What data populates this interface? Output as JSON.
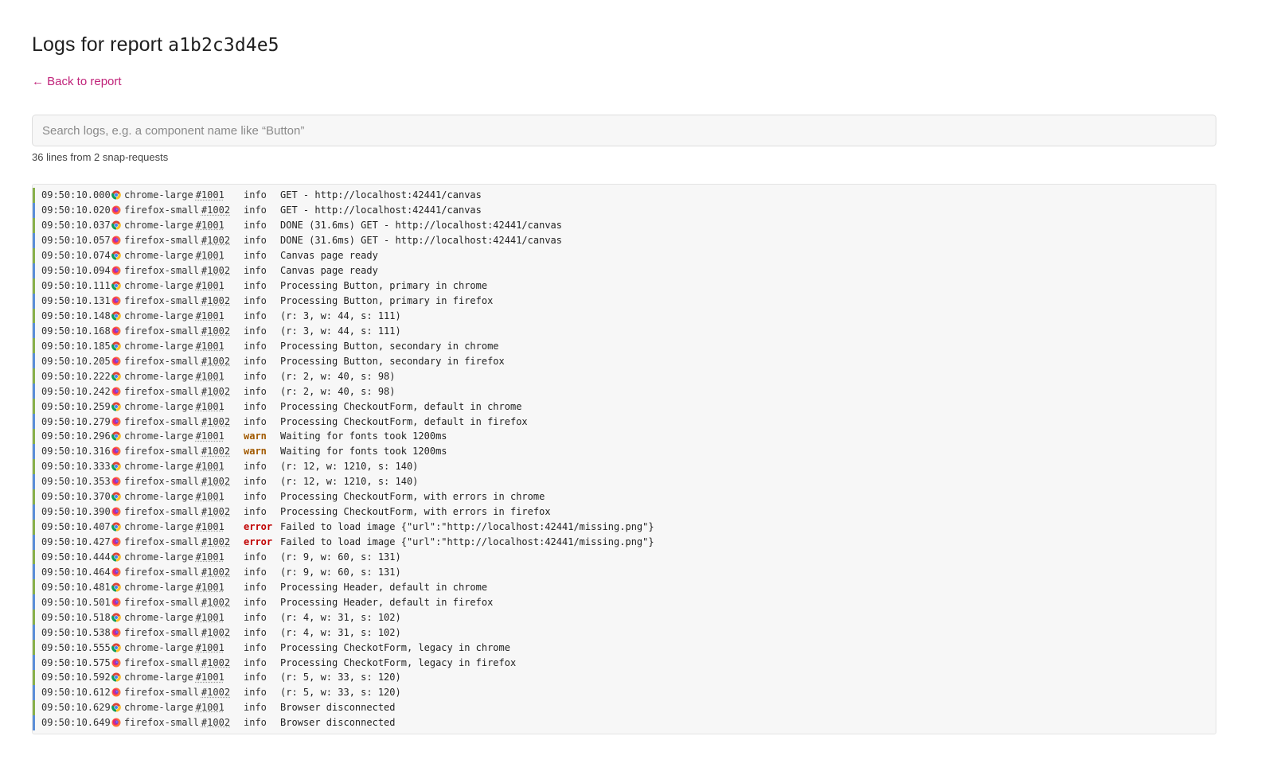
{
  "page": {
    "title_prefix": "Logs for report",
    "report_id": "a1b2c3d4e5",
    "back_link": "← Back to report",
    "search_placeholder": "Search logs, e.g. a component name like “Button”",
    "summary": "36 lines from 2 snap-requests"
  },
  "colors": {
    "chrome_accent": "#88b04b",
    "firefox_accent": "#5b8ed8",
    "link": "#c0237a",
    "warn": "#a15a00",
    "error": "#c00000"
  },
  "browsers": {
    "chrome": {
      "target": "chrome-large",
      "request": "#1001",
      "icon": "chrome-icon"
    },
    "firefox": {
      "target": "firefox-small",
      "request": "#1002",
      "icon": "firefox-icon"
    }
  },
  "logs": [
    {
      "ts": "09:50:10.000",
      "browser": "chrome",
      "level": "info",
      "msg": "GET - http://localhost:42441/canvas"
    },
    {
      "ts": "09:50:10.020",
      "browser": "firefox",
      "level": "info",
      "msg": "GET - http://localhost:42441/canvas"
    },
    {
      "ts": "09:50:10.037",
      "browser": "chrome",
      "level": "info",
      "msg": "DONE (31.6ms) GET - http://localhost:42441/canvas"
    },
    {
      "ts": "09:50:10.057",
      "browser": "firefox",
      "level": "info",
      "msg": "DONE (31.6ms) GET - http://localhost:42441/canvas"
    },
    {
      "ts": "09:50:10.074",
      "browser": "chrome",
      "level": "info",
      "msg": "Canvas page ready"
    },
    {
      "ts": "09:50:10.094",
      "browser": "firefox",
      "level": "info",
      "msg": "Canvas page ready"
    },
    {
      "ts": "09:50:10.111",
      "browser": "chrome",
      "level": "info",
      "msg": "Processing Button, primary in chrome"
    },
    {
      "ts": "09:50:10.131",
      "browser": "firefox",
      "level": "info",
      "msg": "Processing Button, primary in firefox"
    },
    {
      "ts": "09:50:10.148",
      "browser": "chrome",
      "level": "info",
      "msg": "(r: 3, w: 44, s: 111)"
    },
    {
      "ts": "09:50:10.168",
      "browser": "firefox",
      "level": "info",
      "msg": "(r: 3, w: 44, s: 111)"
    },
    {
      "ts": "09:50:10.185",
      "browser": "chrome",
      "level": "info",
      "msg": "Processing Button, secondary in chrome"
    },
    {
      "ts": "09:50:10.205",
      "browser": "firefox",
      "level": "info",
      "msg": "Processing Button, secondary in firefox"
    },
    {
      "ts": "09:50:10.222",
      "browser": "chrome",
      "level": "info",
      "msg": "(r: 2, w: 40, s: 98)"
    },
    {
      "ts": "09:50:10.242",
      "browser": "firefox",
      "level": "info",
      "msg": "(r: 2, w: 40, s: 98)"
    },
    {
      "ts": "09:50:10.259",
      "browser": "chrome",
      "level": "info",
      "msg": "Processing CheckoutForm, default in chrome"
    },
    {
      "ts": "09:50:10.279",
      "browser": "firefox",
      "level": "info",
      "msg": "Processing CheckoutForm, default in firefox"
    },
    {
      "ts": "09:50:10.296",
      "browser": "chrome",
      "level": "warn",
      "msg": "Waiting for fonts took 1200ms"
    },
    {
      "ts": "09:50:10.316",
      "browser": "firefox",
      "level": "warn",
      "msg": "Waiting for fonts took 1200ms"
    },
    {
      "ts": "09:50:10.333",
      "browser": "chrome",
      "level": "info",
      "msg": "(r: 12, w: 1210, s: 140)"
    },
    {
      "ts": "09:50:10.353",
      "browser": "firefox",
      "level": "info",
      "msg": "(r: 12, w: 1210, s: 140)"
    },
    {
      "ts": "09:50:10.370",
      "browser": "chrome",
      "level": "info",
      "msg": "Processing CheckoutForm, with errors in chrome"
    },
    {
      "ts": "09:50:10.390",
      "browser": "firefox",
      "level": "info",
      "msg": "Processing CheckoutForm, with errors in firefox"
    },
    {
      "ts": "09:50:10.407",
      "browser": "chrome",
      "level": "error",
      "msg": "Failed to load image {\"url\":\"http://localhost:42441/missing.png\"}"
    },
    {
      "ts": "09:50:10.427",
      "browser": "firefox",
      "level": "error",
      "msg": "Failed to load image {\"url\":\"http://localhost:42441/missing.png\"}"
    },
    {
      "ts": "09:50:10.444",
      "browser": "chrome",
      "level": "info",
      "msg": "(r: 9, w: 60, s: 131)"
    },
    {
      "ts": "09:50:10.464",
      "browser": "firefox",
      "level": "info",
      "msg": "(r: 9, w: 60, s: 131)"
    },
    {
      "ts": "09:50:10.481",
      "browser": "chrome",
      "level": "info",
      "msg": "Processing Header, default in chrome"
    },
    {
      "ts": "09:50:10.501",
      "browser": "firefox",
      "level": "info",
      "msg": "Processing Header, default in firefox"
    },
    {
      "ts": "09:50:10.518",
      "browser": "chrome",
      "level": "info",
      "msg": "(r: 4, w: 31, s: 102)"
    },
    {
      "ts": "09:50:10.538",
      "browser": "firefox",
      "level": "info",
      "msg": "(r: 4, w: 31, s: 102)"
    },
    {
      "ts": "09:50:10.555",
      "browser": "chrome",
      "level": "info",
      "msg": "Processing CheckotForm, legacy in chrome"
    },
    {
      "ts": "09:50:10.575",
      "browser": "firefox",
      "level": "info",
      "msg": "Processing CheckotForm, legacy in firefox"
    },
    {
      "ts": "09:50:10.592",
      "browser": "chrome",
      "level": "info",
      "msg": "(r: 5, w: 33, s: 120)"
    },
    {
      "ts": "09:50:10.612",
      "browser": "firefox",
      "level": "info",
      "msg": "(r: 5, w: 33, s: 120)"
    },
    {
      "ts": "09:50:10.629",
      "browser": "chrome",
      "level": "info",
      "msg": "Browser disconnected"
    },
    {
      "ts": "09:50:10.649",
      "browser": "firefox",
      "level": "info",
      "msg": "Browser disconnected"
    }
  ]
}
